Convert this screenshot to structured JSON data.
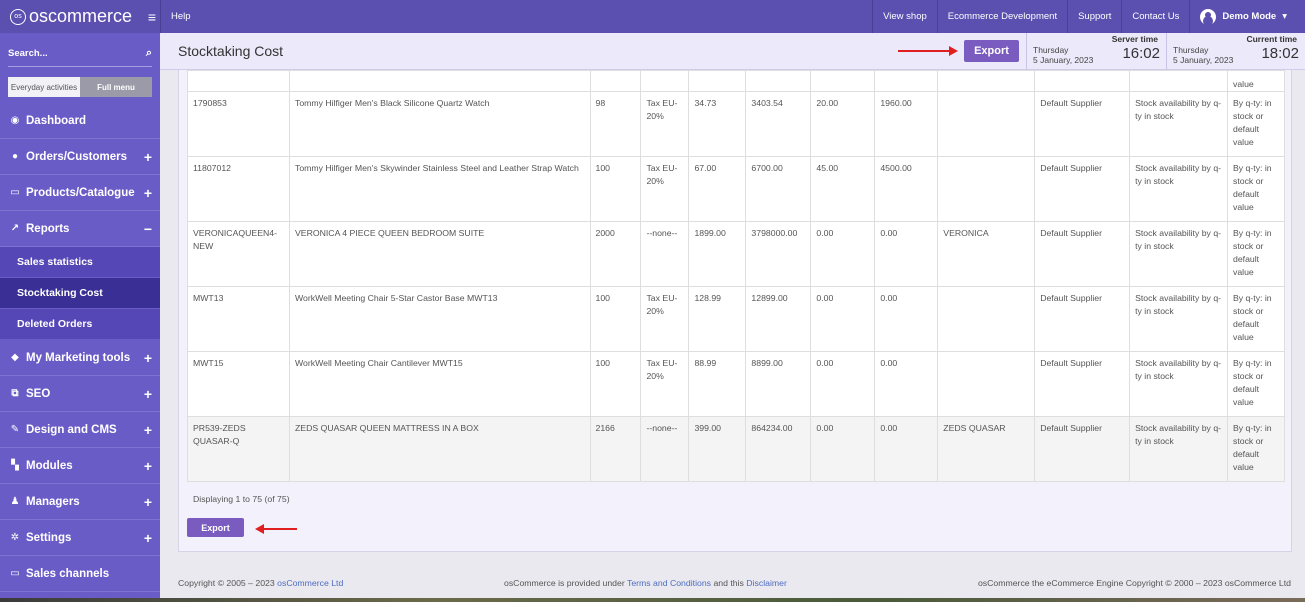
{
  "topbar": {
    "logo": "oscommerce",
    "links": [
      "Help"
    ],
    "right_links": [
      "View shop",
      "Ecommerce Development",
      "Support",
      "Contact Us"
    ],
    "user": "Demo Mode"
  },
  "sidebar": {
    "search_label": "Search...",
    "toggle": [
      "Everyday activities",
      "Full menu"
    ],
    "items": [
      {
        "label": "Dashboard",
        "icon": "dashboard-icon",
        "expand": ""
      },
      {
        "label": "Orders/Customers",
        "icon": "users-icon",
        "expand": "+"
      },
      {
        "label": "Products/Catalogue",
        "icon": "folder-icon",
        "expand": "+"
      },
      {
        "label": "Reports",
        "icon": "chart-icon",
        "expand": "−"
      }
    ],
    "sub_items": [
      "Sales statistics",
      "Stocktaking Cost",
      "Deleted Orders"
    ],
    "items_after": [
      {
        "label": "My Marketing tools",
        "icon": "tag-icon",
        "expand": "+"
      },
      {
        "label": "SEO",
        "icon": "sitemap-icon",
        "expand": "+"
      },
      {
        "label": "Design and CMS",
        "icon": "brush-icon",
        "expand": "+"
      },
      {
        "label": "Modules",
        "icon": "puzzle-icon",
        "expand": "+"
      },
      {
        "label": "Managers",
        "icon": "user-icon",
        "expand": "+"
      },
      {
        "label": "Settings",
        "icon": "gears-icon",
        "expand": "+"
      },
      {
        "label": "Sales channels",
        "icon": "monitor-icon",
        "expand": ""
      }
    ]
  },
  "header": {
    "title": "Stocktaking Cost",
    "export_label": "Export",
    "server_time": {
      "label": "Server time",
      "day": "Thursday",
      "date": "5 January, 2023",
      "time": "16:02"
    },
    "current_time": {
      "label": "Current time",
      "day": "Thursday",
      "date": "5 January, 2023",
      "time": "18:02"
    }
  },
  "table": {
    "top_partial_last": "value",
    "rows": [
      [
        "1790853",
        "Tommy Hilfiger Men's Black Silicone Quartz Watch",
        "98",
        "Tax EU-20%",
        "34.73",
        "3403.54",
        "20.00",
        "1960.00",
        "",
        "Default Supplier",
        "Stock availability by q-ty in stock",
        "By q-ty: in stock or default value"
      ],
      [
        "11807012",
        "Tommy Hilfiger Men's Skywinder Stainless Steel and Leather Strap Watch",
        "100",
        "Tax EU-20%",
        "67.00",
        "6700.00",
        "45.00",
        "4500.00",
        "",
        "Default Supplier",
        "Stock availability by q-ty in stock",
        "By q-ty: in stock or default value"
      ],
      [
        "VERONICAQUEEN4-NEW",
        "VERONICA 4 PIECE QUEEN BEDROOM SUITE",
        "2000",
        "--none--",
        "1899.00",
        "3798000.00",
        "0.00",
        "0.00",
        "VERONICA",
        "Default Supplier",
        "Stock availability by q-ty in stock",
        "By q-ty: in stock or default value"
      ],
      [
        "MWT13",
        "WorkWell Meeting Chair 5-Star Castor Base MWT13",
        "100",
        "Tax EU-20%",
        "128.99",
        "12899.00",
        "0.00",
        "0.00",
        "",
        "Default Supplier",
        "Stock availability by q-ty in stock",
        "By q-ty: in stock or default value"
      ],
      [
        "MWT15",
        "WorkWell Meeting Chair Cantilever MWT15",
        "100",
        "Tax EU-20%",
        "88.99",
        "8899.00",
        "0.00",
        "0.00",
        "",
        "Default Supplier",
        "Stock availability by q-ty in stock",
        "By q-ty: in stock or default value"
      ],
      [
        "PR539-ZEDS QUASAR-Q",
        "ZEDS QUASAR QUEEN MATTRESS IN A BOX",
        "2166",
        "--none--",
        "399.00",
        "864234.00",
        "0.00",
        "0.00",
        "ZEDS QUASAR",
        "Default Supplier",
        "Stock availability by q-ty in stock",
        "By q-ty: in stock or default value"
      ]
    ],
    "paging": "Displaying 1 to 75 (of 75)",
    "export_label": "Export"
  },
  "footer": {
    "copyright_prefix": "Copyright © 2005 – 2023",
    "copyright_link": "osCommerce Ltd",
    "mid_prefix": "osCommerce is provided under",
    "terms_link": "Terms and Conditions",
    "mid_and": "and this",
    "disclaimer_link": "Disclaimer",
    "right": "osCommerce the eCommerce Engine Copyright © 2000 – 2023 osCommerce Ltd"
  },
  "colors": {
    "brand": "#5b4fb0",
    "sidebar": "#6a5cc7",
    "button": "#7a5cc0",
    "arrow": "#e02020"
  }
}
